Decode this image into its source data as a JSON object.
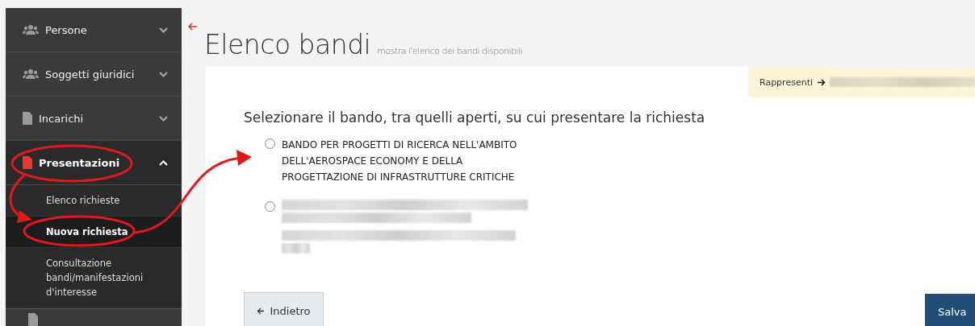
{
  "sidebar": {
    "items": [
      {
        "label": "Persone",
        "kind": "users",
        "expanded": false
      },
      {
        "label": "Soggetti giuridici",
        "kind": "users",
        "expanded": false
      },
      {
        "label": "Incarichi",
        "kind": "document",
        "expanded": false
      },
      {
        "label": "Presentazioni",
        "kind": "document",
        "expanded": true,
        "children": [
          {
            "label": "Elenco richieste",
            "selected": false
          },
          {
            "label": "Nuova richiesta",
            "selected": true
          },
          {
            "label": "Consultazione bandi/manifestazioni d'interesse",
            "selected": false
          }
        ]
      }
    ]
  },
  "page": {
    "title": "Elenco bandi",
    "subtitle": "mostra l'elenco dei bandi disponibili"
  },
  "represent": {
    "label": "Rappresenti"
  },
  "form": {
    "question": "Selezionare il bando, tra quelli aperti, su cui presentare la richiesta",
    "options": [
      {
        "kind": "text",
        "label": "BANDO PER PROGETTI DI RICERCA NELL'AMBITO DELL'AEROSPACE ECONOMY E DELLA PROGETTAZIONE DI INFRASTRUTTURE CRITICHE",
        "selected": false
      },
      {
        "kind": "redacted",
        "selected": false
      }
    ]
  },
  "buttons": {
    "back": "Indietro",
    "save": "Salva"
  }
}
